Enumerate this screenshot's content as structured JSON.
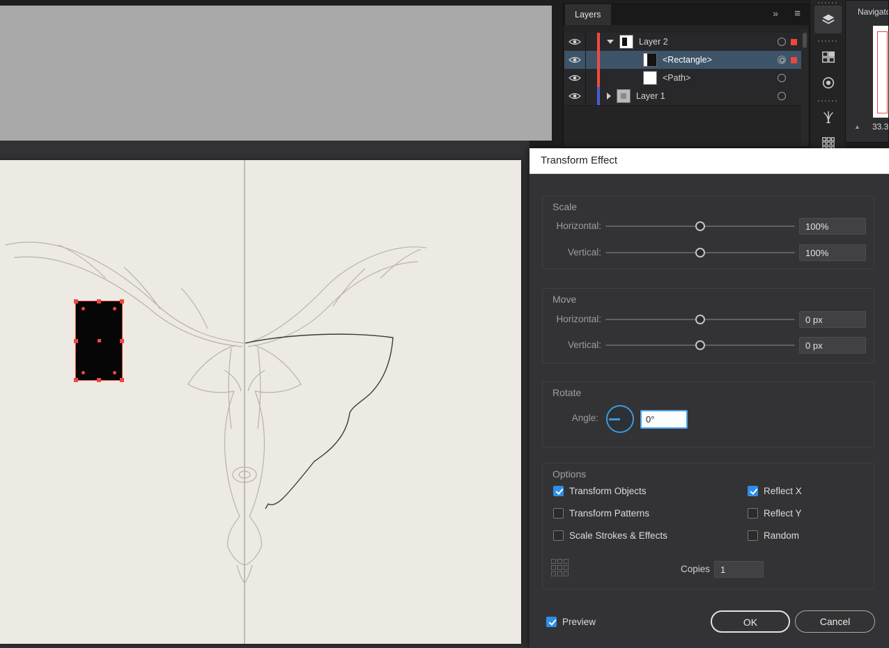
{
  "colors": {
    "accent_blue": "#2e8fe8",
    "selection_red": "#ed4740",
    "layer2_color": "#f04b41",
    "layer1_color": "#4a5ed0"
  },
  "layers_panel": {
    "tab_label": "Layers",
    "collapse_glyph": "»",
    "menu_glyph": "≡",
    "rows": [
      {
        "label": "Layer 2"
      },
      {
        "label": "<Rectangle>"
      },
      {
        "label": "<Path>"
      },
      {
        "label": "Layer 1"
      }
    ]
  },
  "navigator": {
    "title": "Navigator",
    "zoom_value": "33.3"
  },
  "dialog": {
    "title": "Transform Effect",
    "scale": {
      "heading": "Scale",
      "horizontal_label": "Horizontal:",
      "horizontal_value": "100%",
      "vertical_label": "Vertical:",
      "vertical_value": "100%"
    },
    "move": {
      "heading": "Move",
      "horizontal_label": "Horizontal:",
      "horizontal_value": "0 px",
      "vertical_label": "Vertical:",
      "vertical_value": "0 px"
    },
    "rotate": {
      "heading": "Rotate",
      "angle_label": "Angle:",
      "angle_value": "0°"
    },
    "options": {
      "heading": "Options",
      "items": [
        {
          "label": "Transform Objects",
          "checked": true
        },
        {
          "label": "Transform Patterns",
          "checked": false
        },
        {
          "label": "Scale Strokes & Effects",
          "checked": false
        },
        {
          "label": "Reflect X",
          "checked": true
        },
        {
          "label": "Reflect Y",
          "checked": false
        },
        {
          "label": "Random",
          "checked": false
        }
      ],
      "copies_label": "Copies",
      "copies_value": "1"
    },
    "preview_label": "Preview",
    "preview_checked": true,
    "ok_label": "OK",
    "cancel_label": "Cancel"
  }
}
